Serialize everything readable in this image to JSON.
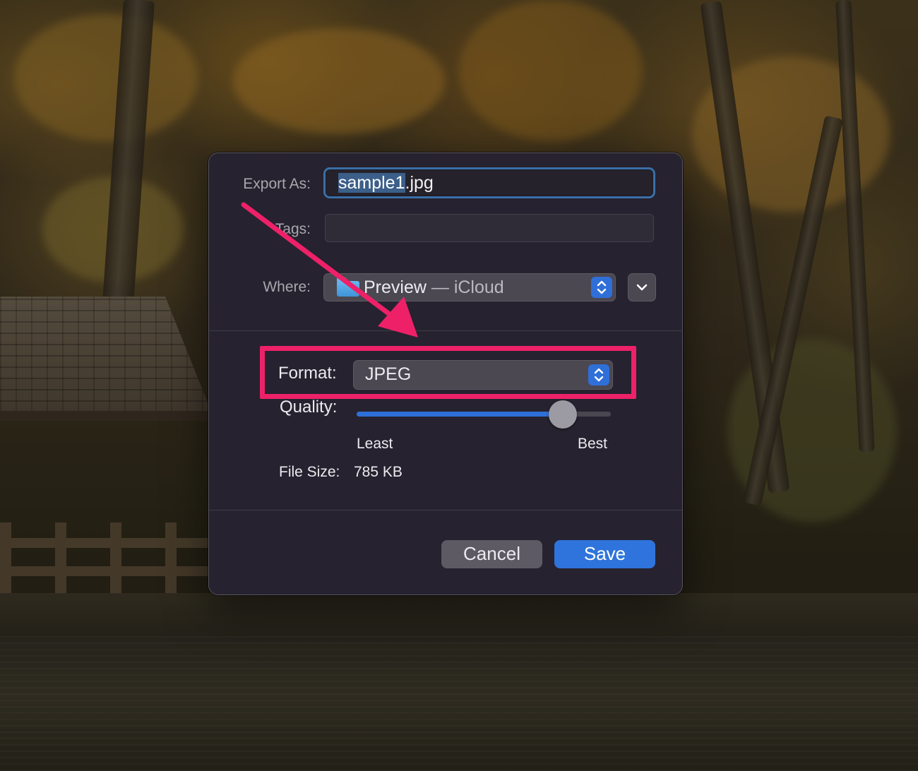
{
  "dialog": {
    "export_as_label": "Export As:",
    "filename_selected": "sample1",
    "filename_extension": ".jpg",
    "tags_label": "Tags:",
    "tags_value": "",
    "where_label": "Where:",
    "where_folder": "Preview",
    "where_location": " — iCloud",
    "format_label": "Format:",
    "format_value": "JPEG",
    "quality_label": "Quality:",
    "quality_fraction": 0.81,
    "quality_min_label": "Least",
    "quality_max_label": "Best",
    "file_size_label": "File Size:",
    "file_size_value": "785 KB",
    "cancel_label": "Cancel",
    "save_label": "Save"
  },
  "icons": {
    "where_folder_icon": "folder-icon",
    "where_stepper_icon": "chevron-up-down-icon",
    "expand_icon": "chevron-down-icon",
    "format_stepper_icon": "chevron-up-down-icon"
  },
  "colors": {
    "accent": "#2f74dc",
    "annotation": "#ee2168",
    "dialog_bg": "#26222f"
  }
}
